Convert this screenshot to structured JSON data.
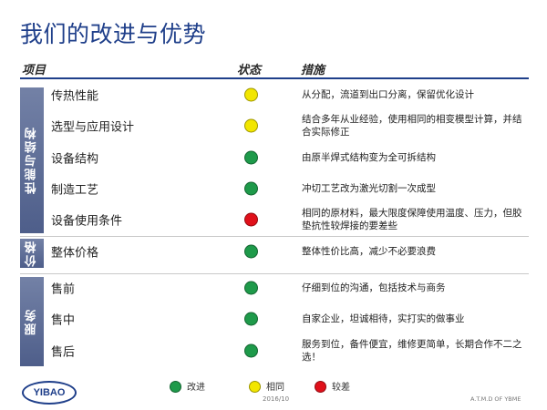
{
  "title": "我们的改进与优势",
  "headers": {
    "item": "项目",
    "status": "状态",
    "measure": "措施"
  },
  "groups": [
    {
      "label": "性能与结构"
    },
    {
      "label": "价格"
    },
    {
      "label": "服务"
    }
  ],
  "rows": [
    {
      "item": "传热性能",
      "status": "相同",
      "measure": "从分配，流道到出口分离，保留优化设计"
    },
    {
      "item": "选型与应用设计",
      "status": "相同",
      "measure": "结合多年从业经验，使用相同的相变模型计算，并结合实际修正"
    },
    {
      "item": "设备结构",
      "status": "改进",
      "measure": "由原半焊式结构变为全可拆结构"
    },
    {
      "item": "制造工艺",
      "status": "改进",
      "measure": "冲切工艺改为激光切割一次成型"
    },
    {
      "item": "设备使用条件",
      "status": "较差",
      "measure": "相同的原材料，最大限度保障使用温度、压力，但胶垫抗性较焊接的要差些"
    },
    {
      "item": "整体价格",
      "status": "改进",
      "measure": "整体性价比高，减少不必要浪费"
    },
    {
      "item": "售前",
      "status": "改进",
      "measure": "仔细到位的沟通，包括技术与商务"
    },
    {
      "item": "售中",
      "status": "改进",
      "measure": "自家企业，坦诚相待，实打实的做事业"
    },
    {
      "item": "售后",
      "status": "改进",
      "measure": "服务到位，备件便宜，维修更简单，长期合作不二之选！"
    }
  ],
  "status_colors": {
    "改进": "#1e9a4a",
    "相同": "#f2e600",
    "较差": "#e0101a"
  },
  "legend": [
    {
      "label": "改进",
      "color": "#1e9a4a"
    },
    {
      "label": "相同",
      "color": "#f2e600"
    },
    {
      "label": "较差",
      "color": "#e0101a"
    }
  ],
  "footer": {
    "logo_text": "YIBAO",
    "date": "2016/10",
    "copyright": "A.T.M.D OF YBME"
  }
}
